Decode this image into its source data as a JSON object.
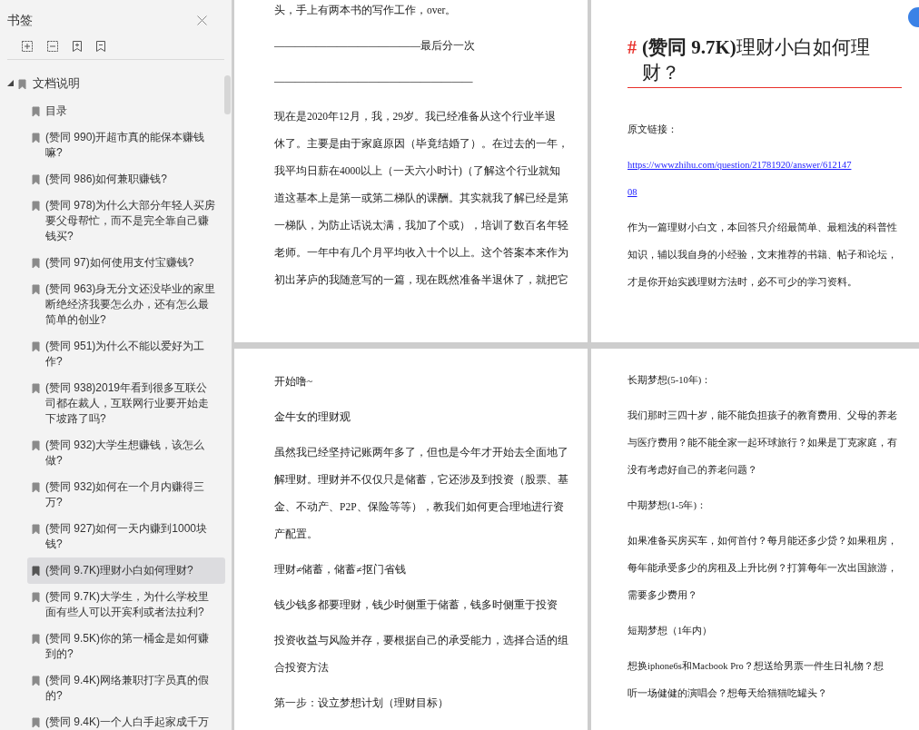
{
  "sidebar": {
    "title": "书签",
    "bookmarks": [
      {
        "label": "文档说明",
        "expanded": true,
        "selected": false,
        "children": [
          {
            "label": "目录",
            "selected": false
          },
          {
            "label": "(赞同 990)开超市真的能保本赚钱嘛?",
            "selected": false
          },
          {
            "label": "(赞同 986)如何兼职赚钱?",
            "selected": false
          },
          {
            "label": "(赞同 978)为什么大部分年轻人买房要父母帮忙，而不是完全靠自己赚钱买?",
            "selected": false
          },
          {
            "label": "(赞同 97)如何使用支付宝赚钱?",
            "selected": false
          },
          {
            "label": "(赞同 963)身无分文还没毕业的家里断绝经济我要怎么办，还有怎么最简单的创业?",
            "selected": false
          },
          {
            "label": "(赞同 951)为什么不能以爱好为工作?",
            "selected": false
          },
          {
            "label": "(赞同 938)2019年看到很多互联公司都在裁人，互联网行业要开始走下坡路了吗?",
            "selected": false
          },
          {
            "label": "(赞同 932)大学生想赚钱，该怎么做?",
            "selected": false
          },
          {
            "label": "(赞同 932)如何在一个月内赚得三万?",
            "selected": false
          },
          {
            "label": "(赞同 927)如何一天内赚到1000块钱?",
            "selected": false
          },
          {
            "label": "(赞同 9.7K)理财小白如何理财?",
            "selected": true
          },
          {
            "label": "(赞同 9.7K)大学生，为什么学校里面有些人可以开宾利或者法拉利?",
            "selected": false
          },
          {
            "label": "(赞同 9.5K)你的第一桶金是如何赚到的?",
            "selected": false
          },
          {
            "label": "(赞同 9.4K)网络兼职打字员真的假的?",
            "selected": false
          },
          {
            "label": "(赞同 9.4K)一个人白手起家成千万",
            "selected": false
          }
        ]
      }
    ]
  },
  "pages": [
    {
      "blocks": [
        {
          "kind": "text",
          "lines": [
            "头，手上有两本书的写作工作，over。"
          ]
        },
        {
          "kind": "text",
          "lines": [
            "——————————————最后分一次"
          ]
        },
        {
          "kind": "text",
          "lines": [
            "———————————————————"
          ]
        },
        {
          "kind": "text",
          "lines": [
            "现在是2020年12月，我，29岁。我已经准备从这个行业半退",
            "休了。主要是由于家庭原因（毕竟结婚了）。在过去的一年，",
            "我平均日薪在4000以上（一天六小时计)（了解这个行业就知",
            "道这基本上是第一或第二梯队的课酬。其实就我了解已经是第",
            "一梯队，为防止话说太满，我加了个或），培训了数百名年轻",
            "老师。一年中有几个月平均收入十个以上。这个答案本来作为",
            "初出茅庐的我随意写的一篇，现在既然准备半退休了，就把它"
          ]
        }
      ]
    },
    {
      "blocks": [
        {
          "kind": "heading",
          "marker": "#",
          "lines": [
            "**(赞同 9.7K)**理财小白如何理",
            "财？"
          ]
        },
        {
          "kind": "text",
          "lines": [
            "原文链接："
          ]
        },
        {
          "kind": "link",
          "lines": [
            "https://wwwzhihu.com/question/21781920/answer/612147",
            "08"
          ]
        },
        {
          "kind": "text",
          "lines": [
            "作为一篇理财小白文，本回答只介绍最简单、最粗浅的科普性",
            "知识，辅以我自身的小经验，文末推荐的书籍、帖子和论坛，",
            "才是你开始实践理财方法时，必不可少的学习资料。"
          ]
        }
      ]
    },
    {
      "blocks": [
        {
          "kind": "text",
          "lines": [
            "开始噜~"
          ]
        },
        {
          "kind": "text",
          "lines": [
            "金牛女的理财观"
          ]
        },
        {
          "kind": "text",
          "lines": [
            "虽然我已经坚持记账两年多了，但也是今年才开始去全面地了",
            "解理财。理财并不仅仅只是储蓄，它还涉及到投资（股票、基",
            "金、不动产、P2P、保险等等），教我们如何更合理地进行资",
            "产配置。"
          ]
        },
        {
          "kind": "text",
          "lines": [
            "理财≠储蓄，储蓄≠抠门省钱"
          ]
        },
        {
          "kind": "text",
          "lines": [
            "钱少钱多都要理财，钱少时侧重于储蓄，钱多时侧重于投资"
          ]
        },
        {
          "kind": "text",
          "lines": [
            "投资收益与风险并存，要根据自己的承受能力，选择合适的组",
            "合投资方法"
          ]
        },
        {
          "kind": "text",
          "lines": [
            "第一步：设立梦想计划（理财目标）"
          ]
        }
      ]
    },
    {
      "blocks": [
        {
          "kind": "text",
          "lines": [
            "长期梦想(5-10年)："
          ]
        },
        {
          "kind": "text",
          "lines": [
            "我们那时三四十岁，能不能负担孩子的教育费用、父母的养老",
            "与医疗费用？能不能全家一起环球旅行？如果是丁克家庭，有",
            "没有考虑好自己的养老问题？"
          ]
        },
        {
          "kind": "text",
          "lines": [
            "中期梦想(1-5年)："
          ]
        },
        {
          "kind": "text",
          "lines": [
            "如果准备买房买车，如何首付？每月能还多少贷？如果租房，",
            "每年能承受多少的房租及上升比例？打算每年一次出国旅游，",
            "需要多少费用？"
          ]
        },
        {
          "kind": "text",
          "lines": [
            "短期梦想（1年内）"
          ]
        },
        {
          "kind": "text",
          "lines": [
            "想换iphone6s和Macbook Pro？想送给男票一件生日礼物？想",
            "听一场健健的演唱会？想每天给猫猫吃罐头？"
          ]
        }
      ]
    }
  ]
}
